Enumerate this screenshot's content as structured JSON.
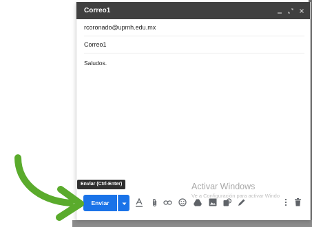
{
  "compose": {
    "title": "Correo1",
    "to": "rcoronado@upmh.edu.mx",
    "subject": "Correo1",
    "body": "Saludos."
  },
  "tooltip": "Enviar (Ctrl-Enter)",
  "send_button": "Enviar",
  "watermark": {
    "title": "Activar Windows",
    "subtitle": "Ve a Configuración para activar Windo"
  },
  "colors": {
    "titlebar": "#404040",
    "send": "#1a73e8",
    "arrow": "#5aab2c"
  },
  "toolbar_icons": [
    "more-send-options-icon",
    "text-format-icon",
    "attach-icon",
    "link-icon",
    "emoji-icon",
    "drive-icon",
    "photo-icon",
    "confidential-mode-icon",
    "signature-icon",
    "more-options-icon",
    "discard-icon"
  ]
}
